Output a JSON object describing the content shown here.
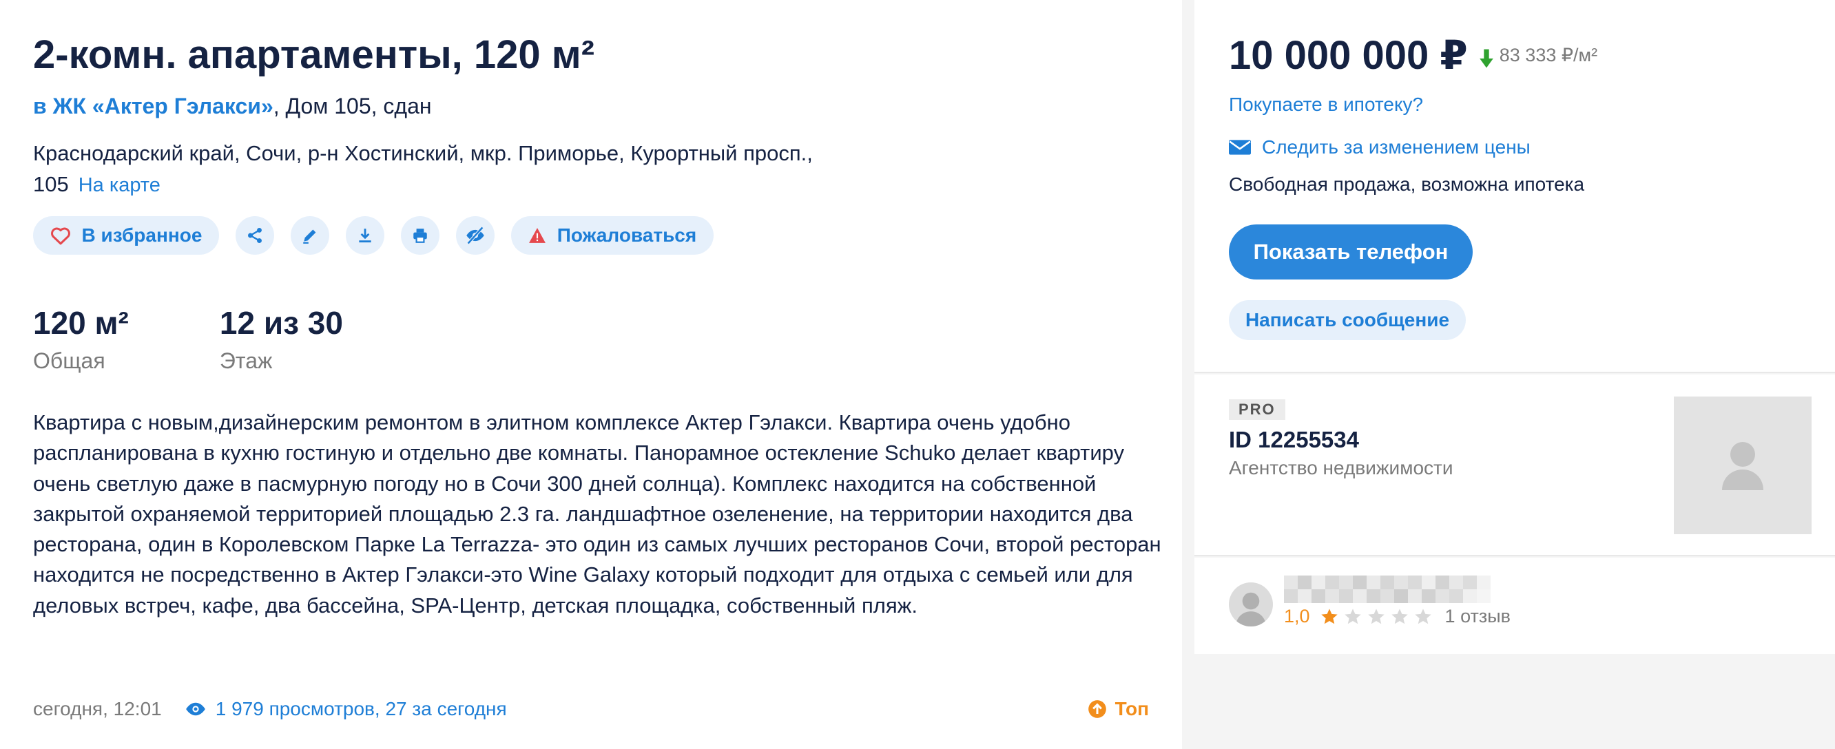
{
  "listing": {
    "title": "2-комн. апартаменты, 120 м²",
    "complex_link": "в ЖК «Актер Гэлакси»",
    "complex_rest": ", Дом 105, сдан",
    "address": "Краснодарский край, Сочи, р-н Хостинский, мкр. Приморье, Курортный просп., 105",
    "map_link": "На карте"
  },
  "actions": {
    "favorite_label": "В избранное",
    "report_label": "Пожаловаться",
    "icons": [
      "heart-icon",
      "share-icon",
      "edit-icon",
      "download-icon",
      "print-icon",
      "hide-icon",
      "warning-icon"
    ]
  },
  "stats": [
    {
      "value": "120 м²",
      "label": "Общая"
    },
    {
      "value": "12 из 30",
      "label": "Этаж"
    }
  ],
  "description": "Квартира с новым,дизайнерским ремонтом в элитном комплексе Актер Гэлакси. Квартира очень удобно распланирована в кухню гостиную и отдельно две комнаты. Панорамное остекление Schuko делает квартиру очень светлую даже в пасмурную погоду но в Сочи 300 дней солнца). Комплекс находится на собственной закрытой охраняемой территорией площадью 2.3 га. ландшафтное озеленение, на территории находится два ресторана, один в Королевском Парке La Terrazza- это один из самых лучших ресторанов Сочи, второй ресторан находится не посредственно в Актер Гэлакси-это Wine Galaxy который подходит для отдыха с семьей или для деловых встреч, кафе, два бассейна, SPA-Центр, детская площадка, собственный пляж.",
  "footer": {
    "date": "сегодня, 12:01",
    "views": "1 979 просмотров, 27 за сегодня",
    "top": "Топ"
  },
  "price_card": {
    "price": "10 000 000 ₽",
    "price_per_m": "83 333 ₽/м²",
    "mortgage_question": "Покупаете в ипотеку?",
    "follow_price": "Следить за изменением цены",
    "sale_type": "Свободная продажа, возможна ипотека",
    "show_phone": "Показать телефон",
    "write_message": "Написать сообщение"
  },
  "agent": {
    "badge": "PRO",
    "id": "ID 12255534",
    "type": "Агентство недвижимости"
  },
  "review": {
    "score": "1,0",
    "rating": 1,
    "max_rating": 5,
    "count": "1 отзыв"
  },
  "colors": {
    "accent": "#1e7ed6",
    "button": "#2b87db",
    "button_light": "#e6f0fb",
    "text": "#152242",
    "muted": "#7a7a7a",
    "orange": "#f28e1c",
    "price_down": "#2fa22f",
    "report": "#e5484d"
  }
}
